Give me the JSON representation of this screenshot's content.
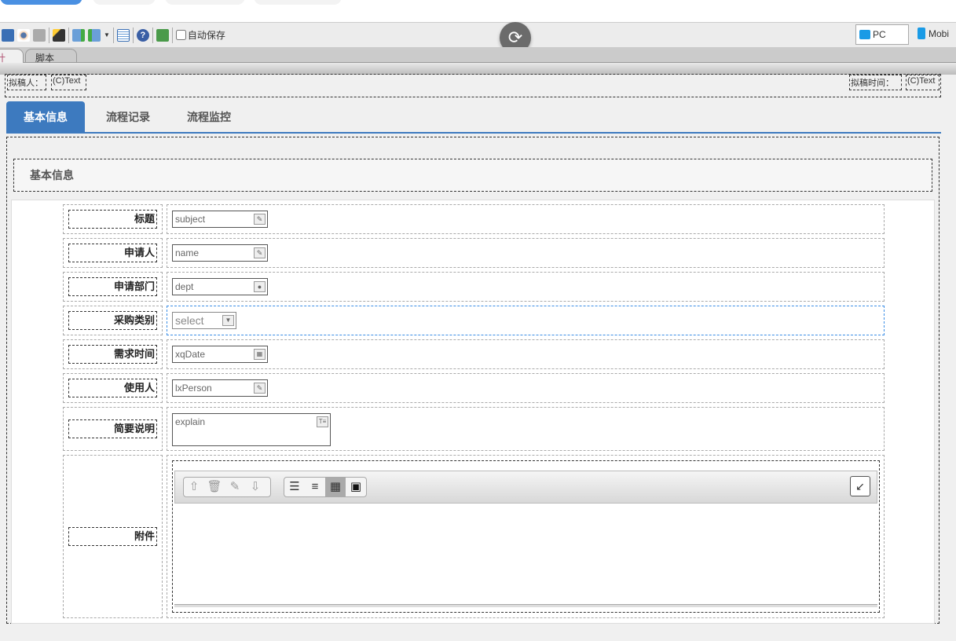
{
  "toolbar": {
    "autosave_label": "自动保存",
    "pc_label": "PC",
    "mobile_label": "Mobi"
  },
  "designer_tabs": [
    "计",
    "脚本"
  ],
  "header": {
    "drafter_label": "拟稿人：",
    "drafter_value": "(C)Text",
    "draft_time_label": "拟稿时间：",
    "draft_time_value": "(C)Text"
  },
  "tabs": [
    "基本信息",
    "流程记录",
    "流程监控"
  ],
  "section_title": "基本信息",
  "fields": [
    {
      "label": "标题",
      "value": "subject",
      "icon": "edit-icon"
    },
    {
      "label": "申请人",
      "value": "name",
      "icon": "edit-icon"
    },
    {
      "label": "申请部门",
      "value": "dept",
      "icon": "user-icon"
    },
    {
      "label": "采购类别",
      "value": "select",
      "icon": "chevron-down-icon"
    },
    {
      "label": "需求时间",
      "value": "xqDate",
      "icon": "calendar-icon"
    },
    {
      "label": "使用人",
      "value": "lxPerson",
      "icon": "edit-icon"
    },
    {
      "label": "简要说明",
      "value": "explain",
      "icon": "textarea-icon"
    },
    {
      "label": "附件",
      "value": "",
      "icon": "attachment"
    }
  ]
}
